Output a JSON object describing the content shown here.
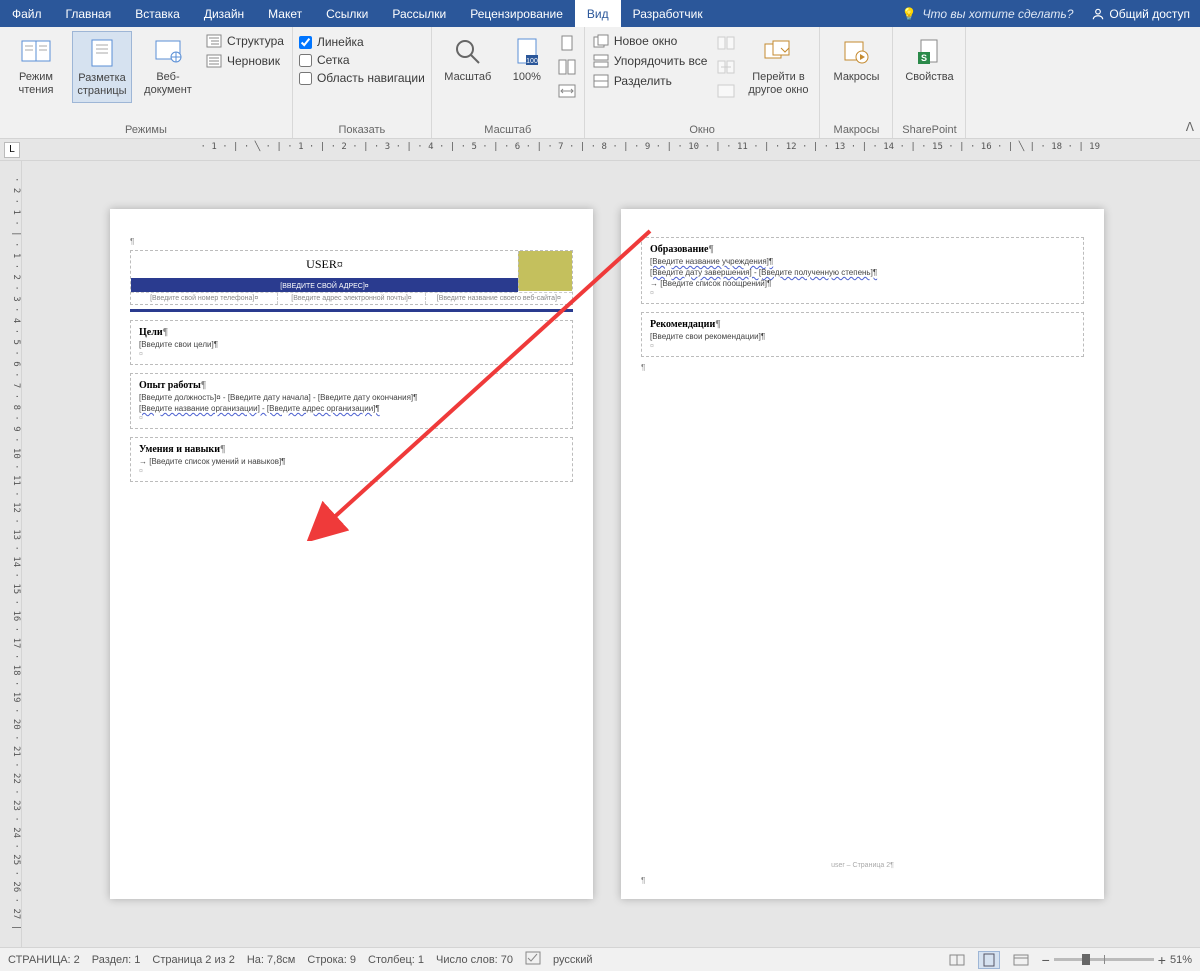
{
  "menu": {
    "file": "Файл",
    "tabs": [
      "Главная",
      "Вставка",
      "Дизайн",
      "Макет",
      "Ссылки",
      "Рассылки",
      "Рецензирование",
      "Вид",
      "Разработчик"
    ],
    "active_index": 7,
    "tell_me": "Что вы хотите сделать?",
    "share": "Общий доступ"
  },
  "ribbon": {
    "modes": {
      "label": "Режимы",
      "read": "Режим чтения",
      "layout": "Разметка страницы",
      "web": "Веб-документ",
      "structure": "Структура",
      "draft": "Черновик"
    },
    "show": {
      "label": "Показать",
      "ruler": "Линейка",
      "grid": "Сетка",
      "nav": "Область навигации"
    },
    "zoom": {
      "label": "Масштаб",
      "zoom": "Масштаб",
      "p100": "100%"
    },
    "window": {
      "label": "Окно",
      "new": "Новое окно",
      "arrange": "Упорядочить все",
      "split": "Разделить",
      "switch": "Перейти в другое окно"
    },
    "macros": {
      "label": "Макросы",
      "btn": "Макросы"
    },
    "sharepoint": {
      "label": "SharePoint",
      "btn": "Свойства"
    }
  },
  "ruler": {
    "horizontal": "· 1 · | · ╲ · | · 1 · | · 2 · | · 3 · | · 4 · | · 5 · | · 6 · | · 7 · | · 8 · | · 9 · | · 10 · | · 11 · | · 12 · | · 13 · | · 14 · | · 15 · | · 16 · | ╲ | · 18 · | 19",
    "vertical": "· 2 · 1 · | · 1 · 2 · 3 · 4 · 5 · 6 · 7 · 8 · 9 · 10 · 11 · 12 · 13 · 14 · 15 · 16 · 17 · 18 · 19 · 20 · 21 · 22 · 23 · 24 · 25 · 26 · 27 |",
    "tabstop": "L"
  },
  "doc": {
    "page1": {
      "name": "USER¤",
      "address": "[ВВЕДИТЕ СВОЙ АДРЕС]¤",
      "contacts": [
        "[Введите свой номер телефона]¤",
        "[Введите адрес электронной почты]¤",
        "[Введите название своего веб-сайта]¤"
      ],
      "sections": [
        {
          "title": "Цели",
          "lines": [
            "[Введите свои цели]¶"
          ]
        },
        {
          "title": "Опыт работы",
          "lines": [
            "[Введите должность]¤ - [Введите дату начала] - [Введите дату окончания]¶",
            "[Введите название организации] - [Введите адрес организации]¶"
          ],
          "wave": true
        },
        {
          "title": "Умения и навыки",
          "lines": [
            "→ [Введите список умений и навыков]¶"
          ]
        }
      ]
    },
    "page2": {
      "sections": [
        {
          "title": "Образование",
          "lines": [
            "[Введите название учреждения]¶",
            "[Введите дату завершения] - [Введите полученную степень]¶",
            "→ [Введите список поощрений]¶"
          ],
          "wave": true
        },
        {
          "title": "Рекомендации",
          "lines": [
            "[Введите свои рекомендации]¶"
          ]
        }
      ],
      "footer": "user – Страница 2¶"
    }
  },
  "status": {
    "page": "СТРАНИЦА: 2",
    "section": "Раздел: 1",
    "page_of": "Страница 2 из 2",
    "pos": "На: 7,8см",
    "line": "Строка: 9",
    "col": "Столбец: 1",
    "words": "Число слов: 70",
    "lang": "русский",
    "zoom": "51%"
  }
}
